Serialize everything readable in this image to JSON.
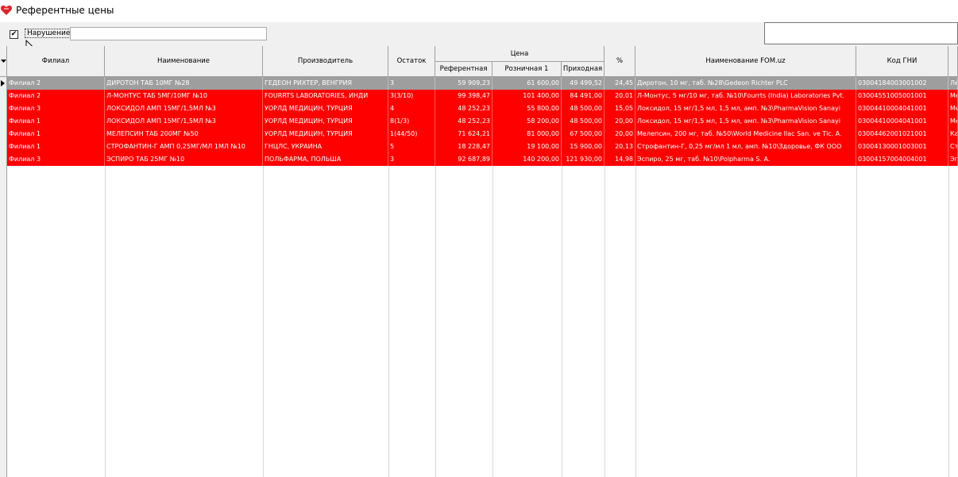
{
  "window": {
    "title": "Референтные цены"
  },
  "filter": {
    "checkbox_mark": "✔",
    "label": "Нарушение",
    "value": ""
  },
  "search": {
    "value": ""
  },
  "colors": {
    "violation_row": "#ff0000",
    "selected_row": "#9e9e9e"
  },
  "columns": {
    "filial": "Филиал",
    "name": "Наименование",
    "manufacturer": "Производитель",
    "stock": "Остаток",
    "price_group": "Цена",
    "ref": "Референтная",
    "retail": "Розничная 1",
    "purchase": "Приходная",
    "percent": "%",
    "fom_name": "Наименование FOM.uz",
    "gni_code": "Код ГНИ"
  },
  "rows": [
    {
      "filial": "Филиал 2",
      "name": "ДИРОТОН ТАБ 10МГ №28",
      "manufacturer": "ГЕДЕОН РИХТЕР, ВЕНГРИЯ",
      "stock": "3",
      "ref": "59 909,23",
      "retail": "61 600,00",
      "purchase": "49 499,52",
      "percent": "24,45",
      "fom_name": "Диротон, 10 мг, таб. №28\\Gedeon Richter PLC",
      "gni_code": "03004184003001002",
      "extra": "Ле",
      "selected": true
    },
    {
      "filial": "Филиал 2",
      "name": "Л-МОНТУС ТАБ 5МГ/10МГ №10",
      "manufacturer": "FOURRTS LABORATORIES, ИНДИ",
      "stock": "3(3/10)",
      "ref": "99 398,47",
      "retail": "101 400,00",
      "purchase": "84 491,00",
      "percent": "20,01",
      "fom_name": "Л-Монтус, 5 мг/10 мг, таб. №10\\Fourrts (India) Laboratories Pvt.",
      "gni_code": "03004551005001001",
      "extra": "Ме",
      "selected": false
    },
    {
      "filial": "Филиал 3",
      "name": "ЛОКСИДОЛ АМП 15МГ/1,5МЛ №3",
      "manufacturer": "УОРЛД МЕДИЦИН, ТУРЦИЯ",
      "stock": "4",
      "ref": "48 252,23",
      "retail": "55 800,00",
      "purchase": "48 500,00",
      "percent": "15,05",
      "fom_name": "Локсидол, 15 мг/1,5 мл, 1,5 мл, амп. №3\\PharmaVision Sanayi",
      "gni_code": "03004410004041001",
      "extra": "Ме",
      "selected": false
    },
    {
      "filial": "Филиал 1",
      "name": "ЛОКСИДОЛ АМП 15МГ/1,5МЛ №3",
      "manufacturer": "УОРЛД МЕДИЦИН, ТУРЦИЯ",
      "stock": "8(1/3)",
      "ref": "48 252,23",
      "retail": "58 200,00",
      "purchase": "48 500,00",
      "percent": "20,00",
      "fom_name": "Локсидол, 15 мг/1,5 мл, 1,5 мл, амп. №3\\PharmaVision Sanayi",
      "gni_code": "03004410004041001",
      "extra": "Ме",
      "selected": false
    },
    {
      "filial": "Филиал 1",
      "name": "МЕЛЕПСИН ТАБ 200МГ №50",
      "manufacturer": "УОРЛД МЕДИЦИН, ТУРЦИЯ",
      "stock": "1(44/50)",
      "ref": "71 624,21",
      "retail": "81 000,00",
      "purchase": "67 500,00",
      "percent": "20,00",
      "fom_name": "Мелепсин, 200 мг, таб. №50\\World Medicine Ilac San. ve Tic. A.",
      "gni_code": "03004462001021001",
      "extra": "Ка",
      "selected": false
    },
    {
      "filial": "Филиал 1",
      "name": "СТРОФАНТИН-Г АМП 0,25МГ/МЛ 1МЛ №10",
      "manufacturer": "ГНЦЛС, УКРАИНА",
      "stock": "5",
      "ref": "18 228,47",
      "retail": "19 100,00",
      "purchase": "15 900,00",
      "percent": "20,13",
      "fom_name": "Строфантин-Г, 0,25 мг/мл 1 мл, амп. №10\\Здоровье, ФК ООО",
      "gni_code": "03004130001003001",
      "extra": "Ст",
      "selected": false
    },
    {
      "filial": "Филиал 3",
      "name": "ЭСПИРО ТАБ 25МГ №10",
      "manufacturer": "ПОЛЬФАРМА, ПОЛЬША",
      "stock": "3",
      "ref": "92 687,89",
      "retail": "140 200,00",
      "purchase": "121 930,00",
      "percent": "14,98",
      "fom_name": "Эспиро, 25 мг, таб. №10\\Polpharma S. A.",
      "gni_code": "03004157004004001",
      "extra": "Эп",
      "selected": false
    }
  ]
}
